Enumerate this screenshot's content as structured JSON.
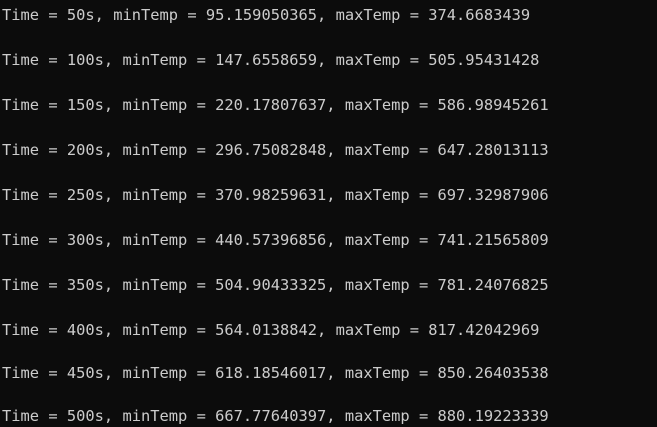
{
  "console": {
    "background": "#0c0c0c",
    "foreground": "#cccccc",
    "lines": [
      "Time = 50s, minTemp = 95.159050365, maxTemp = 374.6683439",
      "Time = 100s, minTemp = 147.6558659, maxTemp = 505.95431428",
      "Time = 150s, minTemp = 220.17807637, maxTemp = 586.98945261",
      "Time = 200s, minTemp = 296.75082848, maxTemp = 647.28013113",
      "Time = 250s, minTemp = 370.98259631, maxTemp = 697.32987906",
      "Time = 300s, minTemp = 440.57396856, maxTemp = 741.21565809",
      "Time = 350s, minTemp = 504.90433325, maxTemp = 781.24076825",
      "Time = 400s, minTemp = 564.0138842, maxTemp = 817.42042969",
      "Time = 450s, minTemp = 618.18546017, maxTemp = 850.26403538",
      "Time = 500s, minTemp = 667.77640397, maxTemp = 880.19223339"
    ]
  }
}
